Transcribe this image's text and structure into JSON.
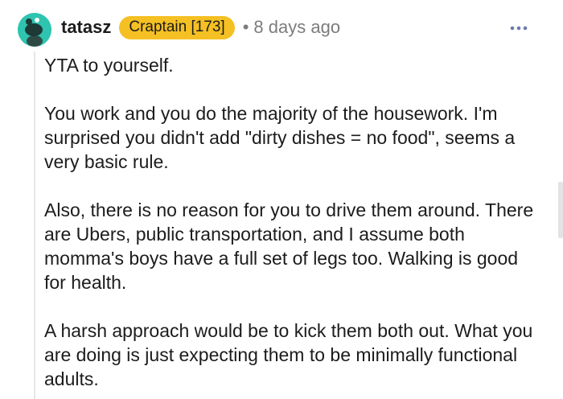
{
  "comment": {
    "author": "tatasz",
    "flair": "Craptain [173]",
    "separator": "•",
    "timestamp": "8 days ago",
    "avatar_icon": "snoo-avatar-icon",
    "more_icon": "more-options-icon",
    "colors": {
      "avatar": "#2ec4b0",
      "flair_bg": "#f5c023",
      "meta_text": "#7c7c7c"
    },
    "paragraphs": [
      "YTA to yourself.",
      "You work and you do the majority of the housework. I'm surprised you didn't add \"dirty dishes = no food\", seems a very basic rule.",
      "Also, there is no reason for you to drive them around. There are Ubers, public transportation, and I assume both momma's boys have a full set of legs too. Walking is good for health.",
      "A harsh approach would be to kick them both out. What you are doing is just expecting them to be minimally functional adults."
    ]
  }
}
